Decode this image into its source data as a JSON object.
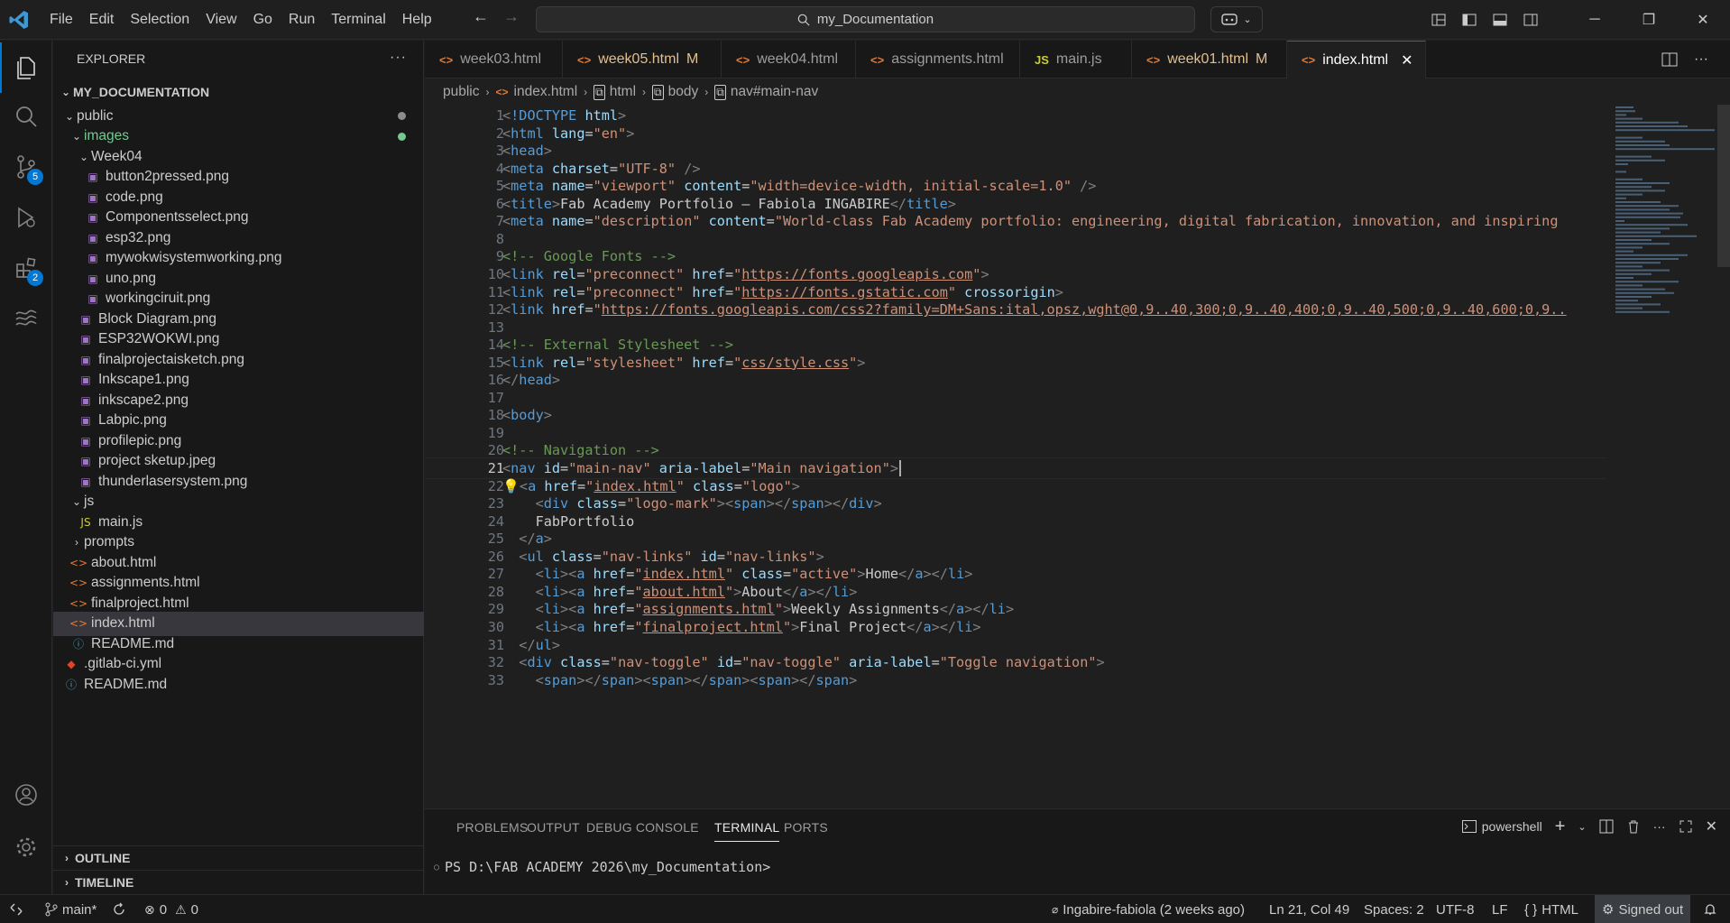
{
  "titlebar": {
    "menu": [
      "File",
      "Edit",
      "Selection",
      "View",
      "Go",
      "Run",
      "Terminal",
      "Help"
    ],
    "search_text": "my_Documentation"
  },
  "activity_bar": {
    "items": [
      "explorer-icon",
      "search-icon",
      "source-control-icon",
      "run-debug-icon",
      "extensions-icon",
      "remote-icon"
    ],
    "source_control_badge": "5",
    "extensions_badge": "2"
  },
  "explorer": {
    "title": "EXPLORER",
    "root": "MY_DOCUMENTATION",
    "tree": [
      {
        "label": "public",
        "type": "folder-open",
        "indent": 0,
        "color": "#cccccc"
      },
      {
        "label": "images",
        "type": "folder-open",
        "indent": 1,
        "color": "#73c991"
      },
      {
        "label": "Week04",
        "type": "folder-open",
        "indent": 2,
        "color": "#cccccc"
      },
      {
        "label": "button2pressed.png",
        "type": "image",
        "indent": 3
      },
      {
        "label": "code.png",
        "type": "image",
        "indent": 3
      },
      {
        "label": "Componentsselect.png",
        "type": "image",
        "indent": 3
      },
      {
        "label": "esp32.png",
        "type": "image",
        "indent": 3
      },
      {
        "label": "mywokwisystemworking.png",
        "type": "image",
        "indent": 3
      },
      {
        "label": "uno.png",
        "type": "image",
        "indent": 3
      },
      {
        "label": "workingciruit.png",
        "type": "image",
        "indent": 3
      },
      {
        "label": "Block Diagram.png",
        "type": "image",
        "indent": 2
      },
      {
        "label": "ESP32WOKWI.png",
        "type": "image",
        "indent": 2
      },
      {
        "label": "finalprojectaisketch.png",
        "type": "image",
        "indent": 2
      },
      {
        "label": "Inkscape1.png",
        "type": "image",
        "indent": 2
      },
      {
        "label": "inkscape2.png",
        "type": "image",
        "indent": 2
      },
      {
        "label": "Labpic.png",
        "type": "image",
        "indent": 2
      },
      {
        "label": "profilepic.png",
        "type": "image",
        "indent": 2
      },
      {
        "label": "project sketup.jpeg",
        "type": "image",
        "indent": 2
      },
      {
        "label": "thunderlasersystem.png",
        "type": "image",
        "indent": 2
      },
      {
        "label": "js",
        "type": "folder-open",
        "indent": 1,
        "color": "#cccccc"
      },
      {
        "label": "main.js",
        "type": "js",
        "indent": 2
      },
      {
        "label": "prompts",
        "type": "folder-closed",
        "indent": 1,
        "color": "#cccccc"
      },
      {
        "label": "about.html",
        "type": "html",
        "indent": 1
      },
      {
        "label": "assignments.html",
        "type": "html",
        "indent": 1
      },
      {
        "label": "finalproject.html",
        "type": "html",
        "indent": 1
      },
      {
        "label": "index.html",
        "type": "html",
        "indent": 1,
        "selected": true
      },
      {
        "label": "README.md",
        "type": "info",
        "indent": 1
      },
      {
        "label": ".gitlab-ci.yml",
        "type": "gitlab",
        "indent": 0
      },
      {
        "label": "README.md",
        "type": "info",
        "indent": 0
      }
    ],
    "outline": "OUTLINE",
    "timeline": "TIMELINE"
  },
  "tabs": [
    {
      "label": "week03.html",
      "icon": "<>",
      "modified": false
    },
    {
      "label": "week05.html",
      "icon": "<>",
      "modified": true,
      "mark": "M"
    },
    {
      "label": "week04.html",
      "icon": "<>",
      "modified": false
    },
    {
      "label": "assignments.html",
      "icon": "<>",
      "modified": false
    },
    {
      "label": "main.js",
      "icon": "JS",
      "modified": false
    },
    {
      "label": "week01.html",
      "icon": "<>",
      "modified": true,
      "mark": "M"
    },
    {
      "label": "index.html",
      "icon": "<>",
      "modified": false,
      "active": true
    }
  ],
  "breadcrumb": [
    "public",
    "index.html",
    "html",
    "body",
    "nav#main-nav"
  ],
  "editor": {
    "current_line": 21,
    "lines": [
      {
        "n": "1",
        "html": "<span class='t'>&lt;</span><span class='tg'>!DOCTYPE</span> <span class='at'>html</span><span class='t'>&gt;</span>"
      },
      {
        "n": "2",
        "html": "<span class='t'>&lt;</span><span class='tg'>html</span> <span class='at'>lang</span><span class='tx'>=</span><span class='s'>\"en\"</span><span class='t'>&gt;</span>"
      },
      {
        "n": "3",
        "html": "<span class='t'>&lt;</span><span class='tg'>head</span><span class='t'>&gt;</span>"
      },
      {
        "n": "4",
        "html": "<span class='t'>&lt;</span><span class='tg'>meta</span> <span class='at'>charset</span><span class='tx'>=</span><span class='s'>\"UTF-8\"</span> <span class='t'>/&gt;</span>"
      },
      {
        "n": "5",
        "html": "<span class='t'>&lt;</span><span class='tg'>meta</span> <span class='at'>name</span><span class='tx'>=</span><span class='s'>\"viewport\"</span> <span class='at'>content</span><span class='tx'>=</span><span class='s'>\"width=device-width, initial-scale=1.0\"</span> <span class='t'>/&gt;</span>"
      },
      {
        "n": "6",
        "html": "<span class='t'>&lt;</span><span class='tg'>title</span><span class='t'>&gt;</span><span class='tx'>Fab Academy Portfolio — Fabiola INGABIRE</span><span class='t'>&lt;/</span><span class='tg'>title</span><span class='t'>&gt;</span>"
      },
      {
        "n": "7",
        "html": "<span class='t'>&lt;</span><span class='tg'>meta</span> <span class='at'>name</span><span class='tx'>=</span><span class='s'>\"description\"</span> <span class='at'>content</span><span class='tx'>=</span><span class='s'>\"World-class Fab Academy portfolio: engineering, digital fabrication, innovation, and inspiring</span>"
      },
      {
        "n": "8",
        "html": ""
      },
      {
        "n": "9",
        "html": "<span class='cm'>&lt;!-- Google Fonts --&gt;</span>"
      },
      {
        "n": "10",
        "html": "<span class='t'>&lt;</span><span class='tg'>link</span> <span class='at'>rel</span><span class='tx'>=</span><span class='s'>\"preconnect\"</span> <span class='at'>href</span><span class='tx'>=</span><span class='s'>\"</span><span class='lk'>https://fonts.googleapis.com</span><span class='s'>\"</span><span class='t'>&gt;</span>"
      },
      {
        "n": "11",
        "html": "<span class='t'>&lt;</span><span class='tg'>link</span> <span class='at'>rel</span><span class='tx'>=</span><span class='s'>\"preconnect\"</span> <span class='at'>href</span><span class='tx'>=</span><span class='s'>\"</span><span class='lk'>https://fonts.gstatic.com</span><span class='s'>\"</span> <span class='at'>crossorigin</span><span class='t'>&gt;</span>"
      },
      {
        "n": "12",
        "html": "<span class='t'>&lt;</span><span class='tg'>link</span> <span class='at'>href</span><span class='tx'>=</span><span class='s'>\"</span><span class='lk'>https://fonts.googleapis.com/css2?family=DM+Sans:ital,opsz,wght@0,9..40,300;0,9..40,400;0,9..40,500;0,9..40,600;0,9..</span>"
      },
      {
        "n": "13",
        "html": ""
      },
      {
        "n": "14",
        "html": "<span class='cm'>&lt;!-- External Stylesheet --&gt;</span>"
      },
      {
        "n": "15",
        "html": "<span class='t'>&lt;</span><span class='tg'>link</span> <span class='at'>rel</span><span class='tx'>=</span><span class='s'>\"stylesheet\"</span> <span class='at'>href</span><span class='tx'>=</span><span class='s'>\"</span><span class='lk'>css/style.css</span><span class='s'>\"</span><span class='t'>&gt;</span>"
      },
      {
        "n": "16",
        "html": "<span class='t'>&lt;/</span><span class='tg'>head</span><span class='t'>&gt;</span>"
      },
      {
        "n": "17",
        "html": ""
      },
      {
        "n": "18",
        "html": "<span class='t'>&lt;</span><span class='tg'>body</span><span class='t'>&gt;</span>"
      },
      {
        "n": "19",
        "html": ""
      },
      {
        "n": "20",
        "html": "<span class='cm'>&lt;!-- Navigation --&gt;</span>"
      },
      {
        "n": "21",
        "html": "<span class='t'>&lt;</span><span class='tg'>nav</span> <span class='at'>id</span><span class='tx'>=</span><span class='s'>\"main-nav\"</span> <span class='at'>aria-label</span><span class='tx'>=</span><span class='s'>\"Main navigation\"</span><span class='t'>&gt;</span>"
      },
      {
        "n": "22",
        "html": "<span style='color:#e2c541'>💡</span><span class='t'>&lt;</span><span class='tg'>a</span> <span class='at'>href</span><span class='tx'>=</span><span class='s'>\"</span><span class='lk'>index.html</span><span class='s'>\"</span> <span class='at'>class</span><span class='tx'>=</span><span class='s'>\"logo\"</span><span class='t'>&gt;</span>"
      },
      {
        "n": "23",
        "html": "    <span class='t'>&lt;</span><span class='tg'>div</span> <span class='at'>class</span><span class='tx'>=</span><span class='s'>\"logo-mark\"</span><span class='t'>&gt;&lt;</span><span class='tg'>span</span><span class='t'>&gt;&lt;/</span><span class='tg'>span</span><span class='t'>&gt;&lt;/</span><span class='tg'>div</span><span class='t'>&gt;</span>"
      },
      {
        "n": "24",
        "html": "    <span class='tx'>FabPortfolio</span>"
      },
      {
        "n": "25",
        "html": "  <span class='t'>&lt;/</span><span class='tg'>a</span><span class='t'>&gt;</span>"
      },
      {
        "n": "26",
        "html": "  <span class='t'>&lt;</span><span class='tg'>ul</span> <span class='at'>class</span><span class='tx'>=</span><span class='s'>\"nav-links\"</span> <span class='at'>id</span><span class='tx'>=</span><span class='s'>\"nav-links\"</span><span class='t'>&gt;</span>"
      },
      {
        "n": "27",
        "html": "    <span class='t'>&lt;</span><span class='tg'>li</span><span class='t'>&gt;&lt;</span><span class='tg'>a</span> <span class='at'>href</span><span class='tx'>=</span><span class='s'>\"</span><span class='lk'>index.html</span><span class='s'>\"</span> <span class='at'>class</span><span class='tx'>=</span><span class='s'>\"active\"</span><span class='t'>&gt;</span><span class='tx'>Home</span><span class='t'>&lt;/</span><span class='tg'>a</span><span class='t'>&gt;&lt;/</span><span class='tg'>li</span><span class='t'>&gt;</span>"
      },
      {
        "n": "28",
        "html": "    <span class='t'>&lt;</span><span class='tg'>li</span><span class='t'>&gt;&lt;</span><span class='tg'>a</span> <span class='at'>href</span><span class='tx'>=</span><span class='s'>\"</span><span class='lk'>about.html</span><span class='s'>\"</span><span class='t'>&gt;</span><span class='tx'>About</span><span class='t'>&lt;/</span><span class='tg'>a</span><span class='t'>&gt;&lt;/</span><span class='tg'>li</span><span class='t'>&gt;</span>"
      },
      {
        "n": "29",
        "html": "    <span class='t'>&lt;</span><span class='tg'>li</span><span class='t'>&gt;&lt;</span><span class='tg'>a</span> <span class='at'>href</span><span class='tx'>=</span><span class='s'>\"</span><span class='lk'>assignments.html</span><span class='s'>\"</span><span class='t'>&gt;</span><span class='tx'>Weekly Assignments</span><span class='t'>&lt;/</span><span class='tg'>a</span><span class='t'>&gt;&lt;/</span><span class='tg'>li</span><span class='t'>&gt;</span>"
      },
      {
        "n": "30",
        "html": "    <span class='t'>&lt;</span><span class='tg'>li</span><span class='t'>&gt;&lt;</span><span class='tg'>a</span> <span class='at'>href</span><span class='tx'>=</span><span class='s'>\"</span><span class='lk'>finalproject.html</span><span class='s'>\"</span><span class='t'>&gt;</span><span class='tx'>Final Project</span><span class='t'>&lt;/</span><span class='tg'>a</span><span class='t'>&gt;&lt;/</span><span class='tg'>li</span><span class='t'>&gt;</span>"
      },
      {
        "n": "31",
        "html": "  <span class='t'>&lt;/</span><span class='tg'>ul</span><span class='t'>&gt;</span>"
      },
      {
        "n": "32",
        "html": "  <span class='t'>&lt;</span><span class='tg'>div</span> <span class='at'>class</span><span class='tx'>=</span><span class='s'>\"nav-toggle\"</span> <span class='at'>id</span><span class='tx'>=</span><span class='s'>\"nav-toggle\"</span> <span class='at'>aria-label</span><span class='tx'>=</span><span class='s'>\"Toggle navigation\"</span><span class='t'>&gt;</span>"
      },
      {
        "n": "33",
        "html": "    <span class='t'>&lt;</span><span class='tg'>span</span><span class='t'>&gt;&lt;/</span><span class='tg'>span</span><span class='t'>&gt;&lt;</span><span class='tg'>span</span><span class='t'>&gt;&lt;/</span><span class='tg'>span</span><span class='t'>&gt;&lt;</span><span class='tg'>span</span><span class='t'>&gt;&lt;/</span><span class='tg'>span</span><span class='t'>&gt;</span>"
      }
    ]
  },
  "panel": {
    "tabs": [
      "PROBLEMS",
      "OUTPUT",
      "DEBUG CONSOLE",
      "TERMINAL",
      "PORTS"
    ],
    "active_tab": "TERMINAL",
    "shell": "powershell",
    "prompt": "PS D:\\FAB ACADEMY 2026\\my_Documentation>"
  },
  "statusbar": {
    "branch": "main*",
    "errors": "0",
    "warnings": "0",
    "blame": "Ingabire-fabiola (2 weeks ago)",
    "position": "Ln 21, Col 49",
    "spaces": "Spaces: 2",
    "encoding": "UTF-8",
    "eol": "LF",
    "language": "HTML",
    "account": "Signed out"
  }
}
